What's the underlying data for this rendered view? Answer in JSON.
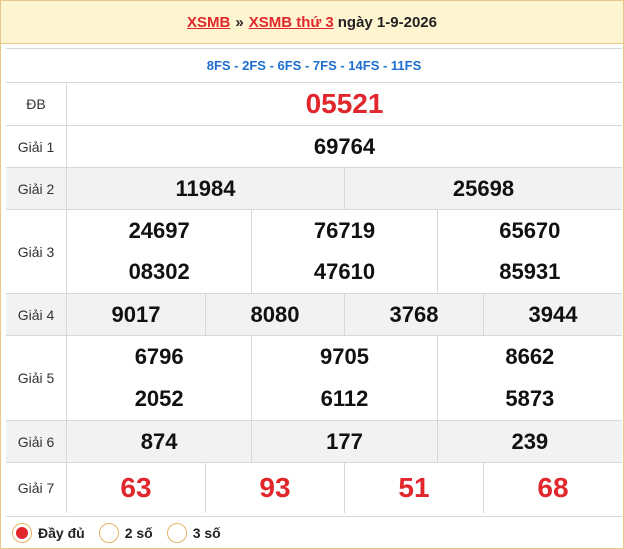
{
  "header": {
    "link1": "XSMB",
    "separator": "»",
    "link2": "XSMB thứ 3",
    "date": "ngày 1-9-2026"
  },
  "fs_line": "8FS - 2FS - 6FS - 7FS - 14FS - 11FS",
  "prizes": {
    "db": {
      "label": "ĐB",
      "numbers": [
        "05521"
      ]
    },
    "g1": {
      "label": "Giải 1",
      "numbers": [
        "69764"
      ]
    },
    "g2": {
      "label": "Giải 2",
      "numbers": [
        "11984",
        "25698"
      ]
    },
    "g3": {
      "label": "Giải 3",
      "numbers": [
        "24697",
        "76719",
        "65670",
        "08302",
        "47610",
        "85931"
      ]
    },
    "g4": {
      "label": "Giải 4",
      "numbers": [
        "9017",
        "8080",
        "3768",
        "3944"
      ]
    },
    "g5": {
      "label": "Giải 5",
      "numbers": [
        "6796",
        "9705",
        "8662",
        "2052",
        "6112",
        "5873"
      ]
    },
    "g6": {
      "label": "Giải 6",
      "numbers": [
        "874",
        "177",
        "239"
      ]
    },
    "g7": {
      "label": "Giải 7",
      "numbers": [
        "63",
        "93",
        "51",
        "68"
      ]
    }
  },
  "footer": {
    "options": [
      {
        "label": "Đầy đủ",
        "selected": true
      },
      {
        "label": "2 số",
        "selected": false
      },
      {
        "label": "3 số",
        "selected": false
      }
    ]
  },
  "colors": {
    "accent_red": "#e1262c",
    "header_bg": "#fff6d1",
    "fs_blue": "#1e6fd0",
    "alt_row": "#f2f2f2"
  }
}
